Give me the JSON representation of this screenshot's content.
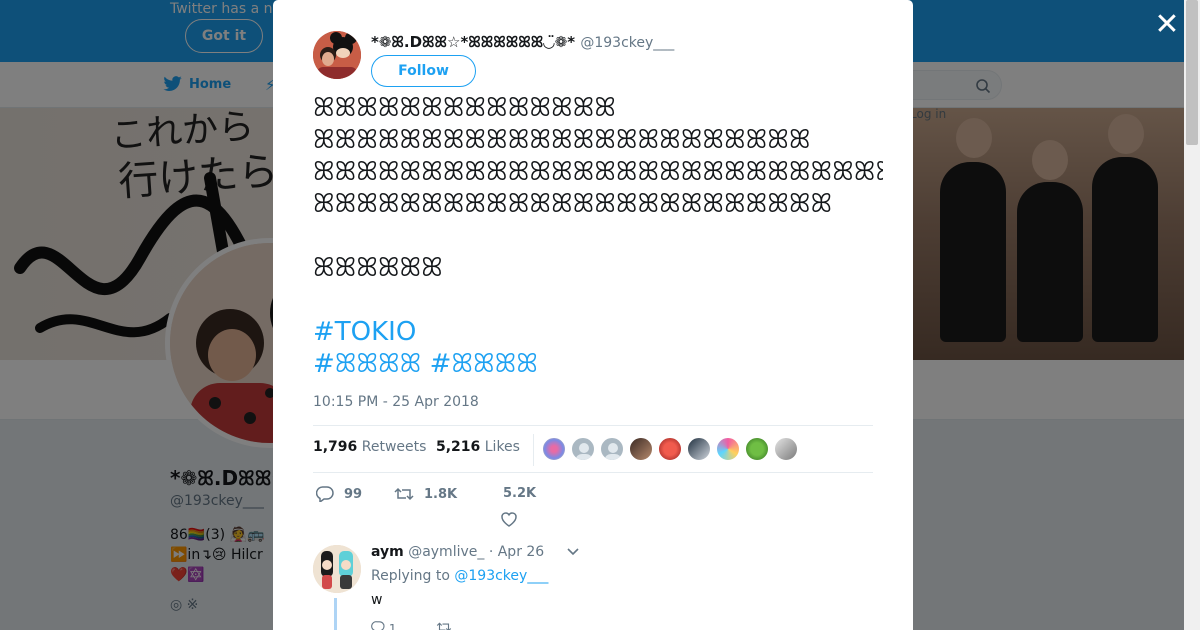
{
  "background": {
    "notice_text": "Twitter has a n",
    "got_it_label": "Got it",
    "nav_home": "Home",
    "login_text": "Log in",
    "banner_text1": "これから",
    "banner_text2": "行けたら",
    "profile_name": "*❁ꕤ.Dꕤꕤ☆",
    "profile_handle": "@193ckey___",
    "profile_bio_line1": "86🏳️‍🌈(3) 👰🚌",
    "profile_bio_line2": "⏩in↴😢 Hilcr",
    "profile_bio_line3": "❤️🔯",
    "profile_location": "◎ ※"
  },
  "tweet": {
    "author_name": "*❁ꕤ.Dꕤꕤ☆*ꕤꕤꕤꕤꕤꕤ◡̈❁*",
    "author_handle": "@193ckey___",
    "follow_label": "Follow",
    "text_lines": [
      "ꕤꕤꕤꕤꕤꕤꕤꕤꕤꕤꕤꕤꕤꕤ",
      "ꕤꕤꕤꕤꕤꕤꕤꕤꕤꕤꕤꕤꕤꕤꕤꕤꕤꕤꕤꕤꕤꕤꕤ",
      "ꕤꕤꕤꕤꕤꕤꕤꕤꕤꕤꕤꕤꕤꕤꕤꕤꕤꕤꕤꕤꕤꕤꕤꕤꕤꕤꕤꕤꕤꕤꕤꕤꕤꕤꕤ",
      "ꕤꕤꕤꕤꕤꕤꕤꕤꕤꕤꕤꕤꕤꕤꕤꕤꕤꕤꕤꕤꕤꕤꕤꕤ",
      "ꕤꕤꕤꕤꕤꕤ"
    ],
    "hashtag1": "#TOKIO",
    "hashtag2": "#ꕤꕤꕤꕤ",
    "hashtag3": "#ꕤꕤꕤꕤ",
    "timestamp": "10:15 PM - 25 Apr 2018",
    "retweets_count": "1,796",
    "retweets_label": "Retweets",
    "likes_count": "5,216",
    "likes_label": "Likes",
    "reply_count": "99",
    "retweet_action_count": "1.8K",
    "like_action_count": "5.2K"
  },
  "reply": {
    "name": "aym",
    "handle": "@aymlive_",
    "date": "· Apr 26",
    "replying_prefix": "Replying to",
    "replying_to": "@193ckey___",
    "body": "w",
    "reply_count": "1"
  },
  "colors": {
    "accent": "#1da1f2",
    "text": "#14171a",
    "muted": "#657786"
  }
}
